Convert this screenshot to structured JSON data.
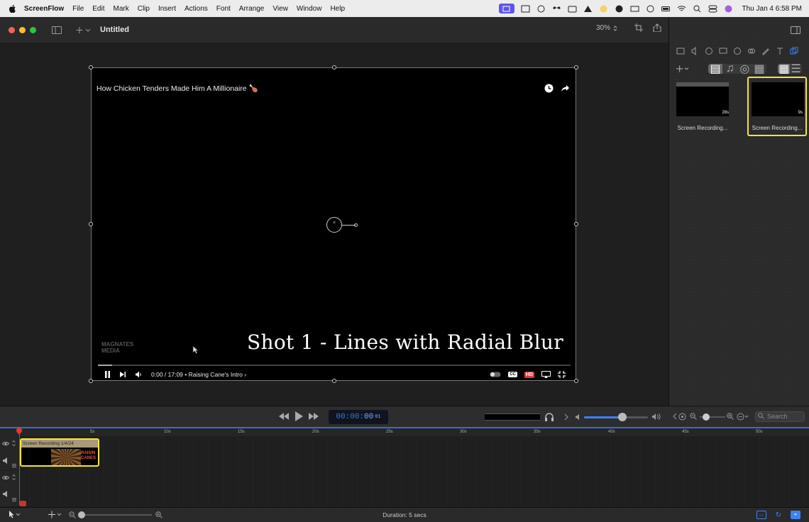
{
  "menubar": {
    "app_name": "ScreenFlow",
    "menus": [
      "File",
      "Edit",
      "Mark",
      "Clip",
      "Insert",
      "Actions",
      "Font",
      "Arrange",
      "View",
      "Window",
      "Help"
    ],
    "clock": "Thu Jan 4  6:58 PM"
  },
  "titlebar": {
    "document_title": "Untitled",
    "zoom_level": "30%"
  },
  "media_library": {
    "items": [
      {
        "caption": "Screen Recording...",
        "duration": "28s",
        "selected": false
      },
      {
        "caption": "Screen Recording...",
        "duration": "9s",
        "selected": true
      }
    ]
  },
  "video": {
    "title": "How Chicken Tenders Made Him A Millionaire 🍗",
    "caption": "Shot 1 - Lines with Radial Blur",
    "watermark": "MAGNATES MEDIA",
    "time_display": "0:00 / 17:09 • Raising Cane's Intro ›",
    "center_symbol": "×",
    "hd_label": "HD",
    "cc_label": "CC"
  },
  "transport": {
    "timecode_prefix": "00:00:",
    "timecode_sec": "00",
    "timecode_frames": "01",
    "volume": 0.6,
    "search_placeholder": "Search"
  },
  "ruler": {
    "ticks": [
      "5s",
      "10s",
      "15s",
      "20s",
      "25s",
      "30s",
      "35s",
      "40s",
      "45s",
      "50s"
    ]
  },
  "timeline": {
    "clip_label": "Screen Recording 1/4/24",
    "clip_logo": "RAISIN CANES"
  },
  "bottombar": {
    "duration": "Duration: 5 secs"
  },
  "colors": {
    "accent": "#3b82f6",
    "selection": "#f4e53b",
    "playhead": "#e33333",
    "close": "#ff5f57",
    "minimize": "#febc2e",
    "maximize": "#28c840",
    "hd_red": "#e53935"
  }
}
